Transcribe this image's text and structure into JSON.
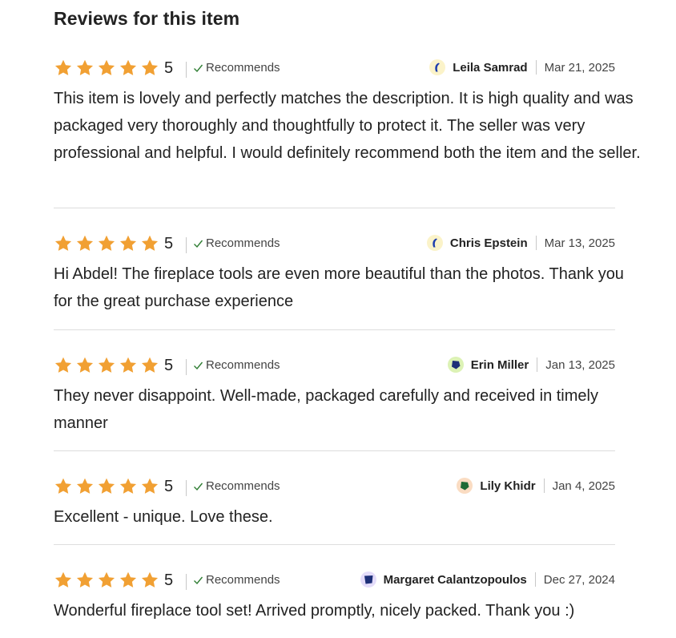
{
  "section": {
    "title": "Reviews for this item"
  },
  "colors": {
    "star": "#f1a033",
    "check": "#2e7d32",
    "text": "#222222",
    "muted": "#444444",
    "divider": "#dddddd"
  },
  "reviews": [
    {
      "rating": 5,
      "rating_label": "5",
      "recommends_label": "Recommends",
      "reviewer": "Leila Samrad",
      "date": "Mar 21, 2025",
      "avatar_icon": "crescent-avatar-icon",
      "avatar_bg": "#fbf3c9",
      "avatar_fg": "#1f3fae",
      "text": "This item is lovely and perfectly matches the description. It is high quality and was packaged very thoroughly and thoughtfully to protect it. The seller was very professional and helpful. I would definitely recommend both the item and the seller."
    },
    {
      "rating": 5,
      "rating_label": "5",
      "recommends_label": "Recommends",
      "reviewer": "Chris Epstein",
      "date": "Mar 13, 2025",
      "avatar_icon": "crescent-avatar-icon",
      "avatar_bg": "#fbf3c9",
      "avatar_fg": "#1f3fae",
      "text": "Hi Abdel! The fireplace tools are even more beautiful than the photos. Thank you for the great purchase experience"
    },
    {
      "rating": 5,
      "rating_label": "5",
      "recommends_label": "Recommends",
      "reviewer": "Erin Miller",
      "date": "Jan 13, 2025",
      "avatar_icon": "pentagon-avatar-icon",
      "avatar_bg": "#dcf2b5",
      "avatar_fg": "#1d2f78",
      "text": "They never disappoint. Well-made, packaged carefully and received in timely manner"
    },
    {
      "rating": 5,
      "rating_label": "5",
      "recommends_label": "Recommends",
      "reviewer": "Lily Khidr",
      "date": "Jan 4, 2025",
      "avatar_icon": "pentagon-avatar-icon",
      "avatar_bg": "#fadcc2",
      "avatar_fg": "#1e6a34",
      "text": "Excellent - unique. Love these."
    },
    {
      "rating": 5,
      "rating_label": "5",
      "recommends_label": "Recommends",
      "reviewer": "Margaret Calantzopoulos",
      "date": "Dec 27, 2024",
      "avatar_icon": "square-avatar-icon",
      "avatar_bg": "#e4dcfa",
      "avatar_fg": "#1d2f78",
      "text": "Wonderful fireplace tool set! Arrived promptly, nicely packed. Thank  you :)"
    }
  ]
}
